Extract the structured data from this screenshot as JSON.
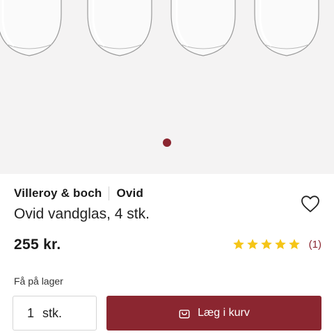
{
  "gallery": {
    "image_count": 1,
    "active_dot": 1
  },
  "product": {
    "brand": "Villeroy & boch",
    "series": "Ovid",
    "title": "Ovid vandglas, 4 stk.",
    "price": "255 kr.",
    "rating": 5,
    "review_count": "(1)"
  },
  "stock": {
    "status": "Få på lager"
  },
  "purchase": {
    "quantity": "1",
    "unit": "stk.",
    "add_to_cart_label": "Læg i kurv"
  },
  "colors": {
    "accent": "#8b2630",
    "star": "#f5c518",
    "gallery_bg": "#f4f3f3"
  },
  "icons": {
    "wishlist": "heart-outline-icon",
    "cart": "shopping-bag-icon",
    "rating": "star-icon"
  }
}
